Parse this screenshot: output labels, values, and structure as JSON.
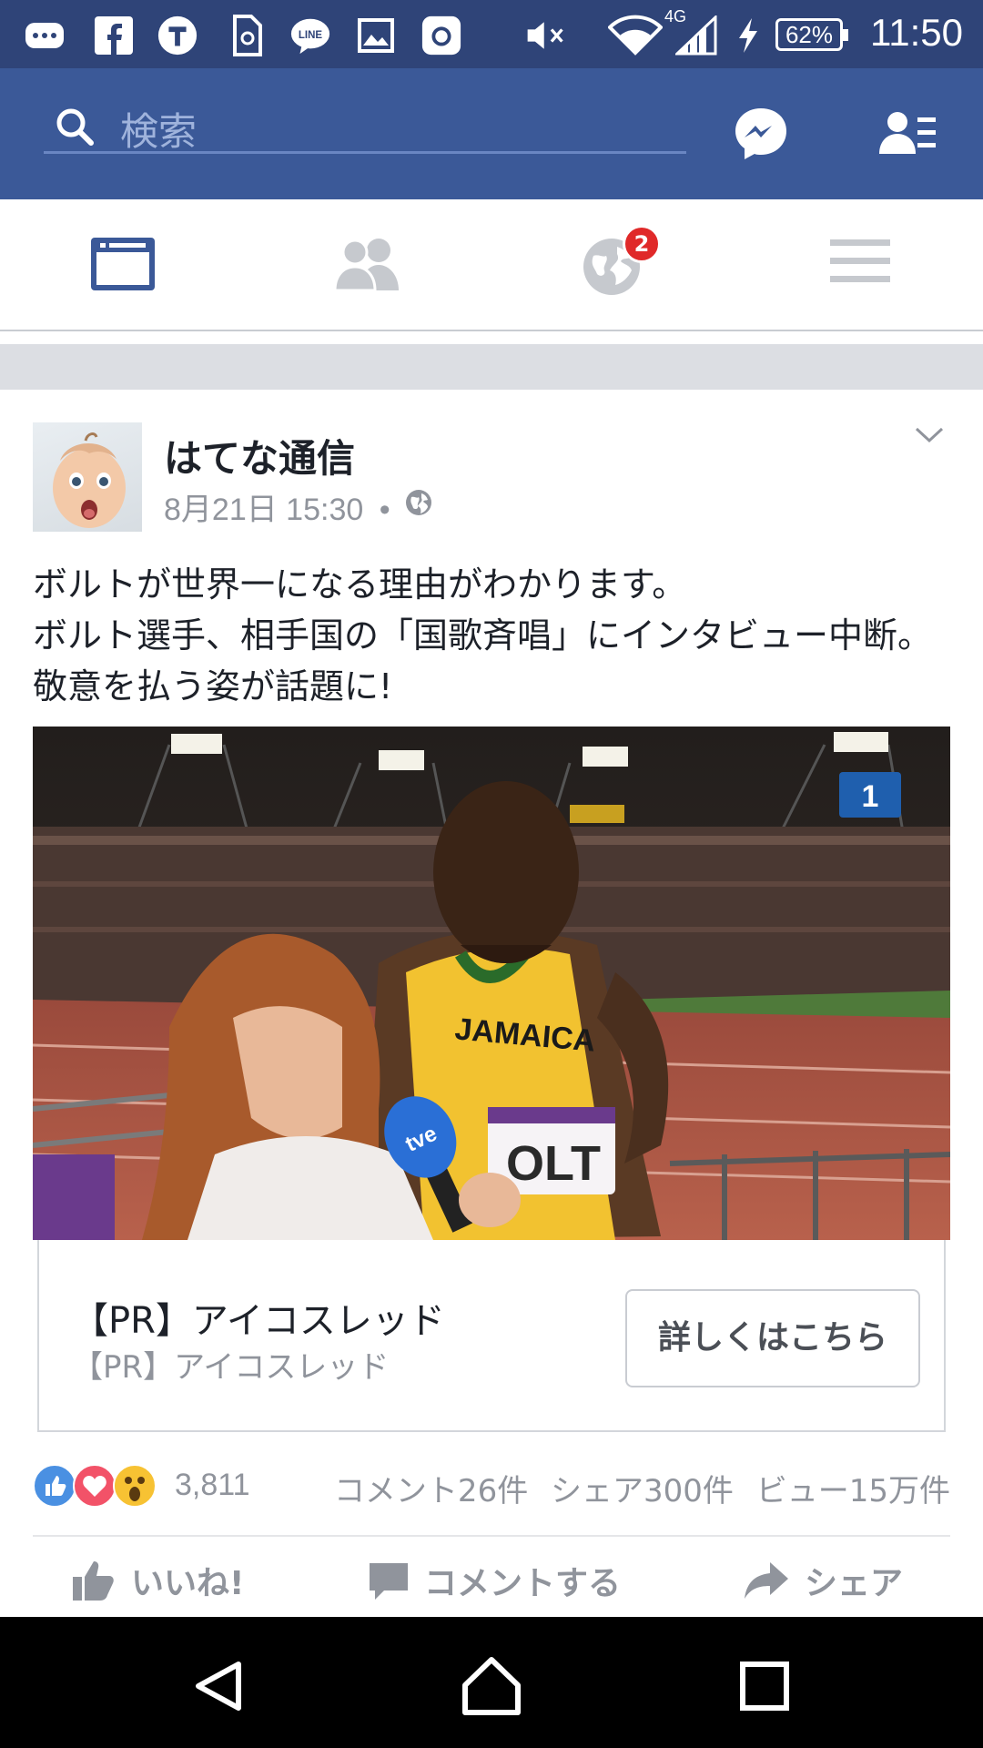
{
  "status_bar": {
    "time": "11:50",
    "battery": "62%",
    "network": "4G",
    "notification_icons": [
      "chat-bubble-icon",
      "facebook-icon",
      "t-app-icon",
      "sim-icon",
      "line-icon",
      "image-icon",
      "instagram-icon"
    ],
    "system_icons": [
      "mute-icon",
      "wifi-icon",
      "signal-icon",
      "charging-icon"
    ]
  },
  "search": {
    "placeholder": "検索"
  },
  "tabs": [
    {
      "name": "news-feed",
      "icon": "feed-icon",
      "active": true
    },
    {
      "name": "friends",
      "icon": "friends-icon",
      "active": false
    },
    {
      "name": "notifications",
      "icon": "globe-icon",
      "badge": "2",
      "active": false
    },
    {
      "name": "menu",
      "icon": "hamburger-icon",
      "active": false
    }
  ],
  "post": {
    "author": "はてな通信",
    "timestamp": "8月21日 15:30",
    "separator": "•",
    "text": "ボルトが世界一になる理由がわかります。\nボルト選手、相手国の「国歌斉唱」にインタビュー中断。敬意を払う姿が話題に!",
    "image_texts": {
      "jersey": "JAMAICA",
      "bib": "OLT",
      "scoreboard": "1",
      "mic": "tve"
    }
  },
  "link_card": {
    "title": "【PR】アイコスレッド",
    "subtitle": "【PR】アイコスレッド",
    "button_label": "詳しくはこちら"
  },
  "reactions": {
    "count": "3,811",
    "types": [
      "like",
      "love",
      "wow"
    ],
    "colors": {
      "like": "#4a90e2",
      "love": "#f25268",
      "wow": "#f7c233"
    }
  },
  "stats": {
    "comments": "コメント26件",
    "shares": "シェア300件",
    "views": "ビュー15万件"
  },
  "actions": {
    "like": "いいね!",
    "comment": "コメントする",
    "share": "シェア"
  },
  "colors": {
    "brand_blue": "#3b5998",
    "status_bar": "#2f4478",
    "badge_red": "#e02929",
    "meta_gray": "#90949c"
  }
}
